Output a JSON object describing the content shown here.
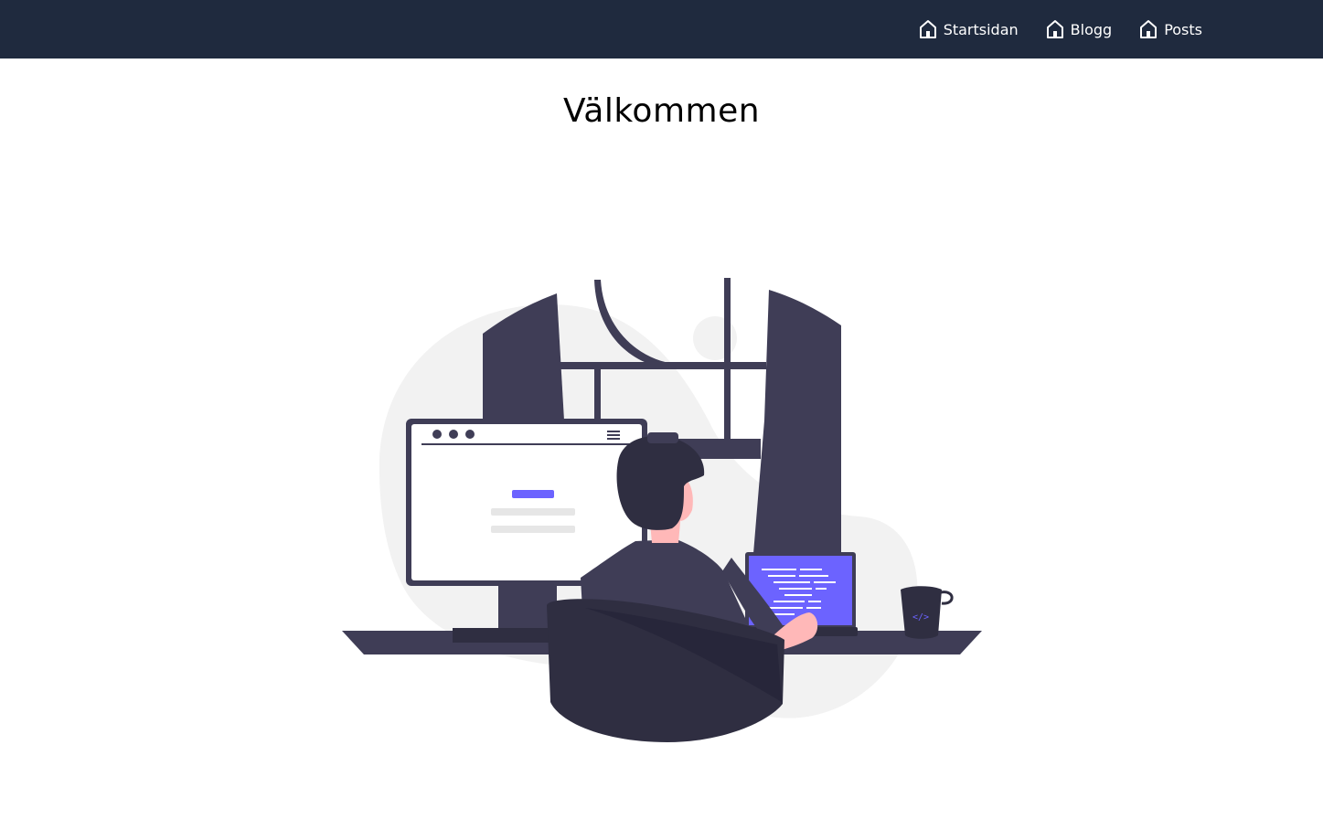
{
  "nav": {
    "items": [
      {
        "label": "Startsidan",
        "icon": "home-icon"
      },
      {
        "label": "Blogg",
        "icon": "home-icon"
      },
      {
        "label": "Posts",
        "icon": "home-icon"
      }
    ]
  },
  "main": {
    "title": "Välkommen",
    "illustration": "developer-at-desk-illustration"
  },
  "colors": {
    "navbar": "#1f2a3e",
    "accent": "#6c63ff",
    "dark": "#3f3d56",
    "hair": "#2f2e41",
    "skin": "#ffb8b8",
    "blob": "#f2f2f2"
  }
}
